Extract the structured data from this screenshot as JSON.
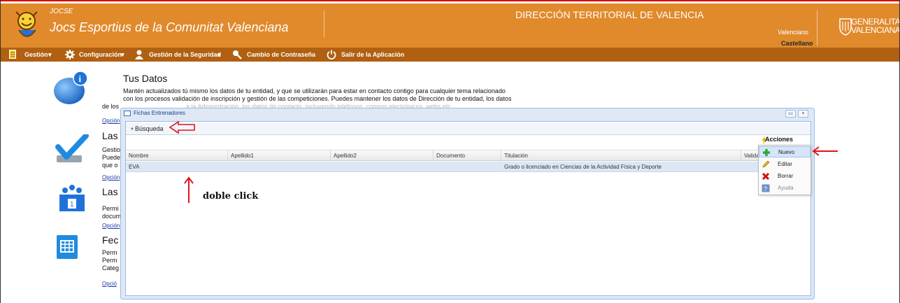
{
  "header": {
    "brand_small": "JOCSE",
    "brand_title": "Jocs Esportius de la Comunitat Valenciana",
    "center_title": "DIRECCIÓN TERRITORIAL DE VALENCIA",
    "lang_1": "Valenciano",
    "lang_2": "Castellano",
    "logo_text_1": "GENERALITAT",
    "logo_text_2": "VALENCIANA"
  },
  "menu": {
    "items": [
      {
        "label": "Gestión",
        "icon": "document-icon"
      },
      {
        "label": "Configuración",
        "icon": "gear-icon"
      },
      {
        "label": "Gestión de la Seguridad",
        "icon": "user-icon"
      },
      {
        "label": "Cambio de Contraseña",
        "icon": "key-icon"
      },
      {
        "label": "Salir de la Aplicación",
        "icon": "power-icon"
      }
    ]
  },
  "background": {
    "tus_datos_title": "Tus Datos",
    "tus_datos_line1": "Mantén actualizados tú mismo los datos de tu entidad, y que se utilizarán para estar en contacto contigo para cualquier tema relacionado",
    "tus_datos_line2": "con los procesos validación de inscripción y gestión de las competiciones. Puedes mantener los datos de Dirección de tu entidad, los datos",
    "tus_datos_line3": "de los",
    "tus_datos_line3b": "a la Administración, los datos de contacto, incluyendo teléfonos, correos electrónicos, webs etc.",
    "link_1": "Opción",
    "block2_title": "Las",
    "block2_line1": "Gestio",
    "block2_line2": "Puede",
    "block2_line3": "que o",
    "link_2": "Opción",
    "block3_title": "Las",
    "block3_line1": "Permi",
    "block3_line2": "docum",
    "link_3": "Opción",
    "block4_title": "Fec",
    "block4_line1": "Perm",
    "block4_line2": "Perm",
    "block4_line3": "Categ",
    "link_4": "Opció"
  },
  "dialog": {
    "title": "Fichas Entrenadores",
    "busqueda_label": "Búsqueda",
    "columns": [
      "Nombre",
      "Apellido1",
      "Apellido2",
      "Documento",
      "Titulación",
      "Valida"
    ],
    "rows": [
      {
        "nombre": "EVA",
        "apellido1": "",
        "apellido2": "",
        "documento": "",
        "titulacion": "Grado o licenciado en Ciencias de la Actividad Física y Deporte",
        "valida": ""
      }
    ],
    "minimize_glyph": "▭",
    "close_glyph": "×"
  },
  "actions": {
    "title": "Acciones",
    "items": [
      {
        "label": "Nuevo",
        "icon": "plus-icon"
      },
      {
        "label": "Editar",
        "icon": "pencil-icon"
      },
      {
        "label": "Borrar",
        "icon": "delete-icon"
      },
      {
        "label": "Ayuda",
        "icon": "help-icon"
      }
    ]
  },
  "annotation": {
    "text": "doble click",
    "arrow_color": "#e0141b"
  },
  "colors": {
    "header_orange": "#e08a2c",
    "menubar_brown": "#b06010",
    "accent_red": "#d40000"
  }
}
